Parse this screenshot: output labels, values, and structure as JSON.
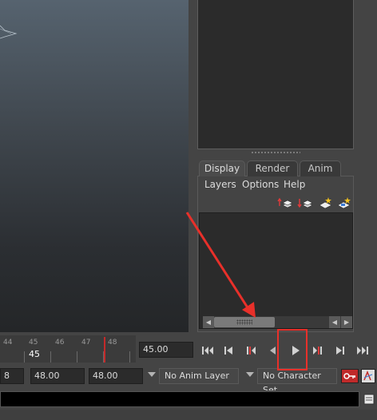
{
  "timeline": {
    "tick_labels": [
      "44",
      "45",
      "46",
      "47",
      "48"
    ],
    "current_frame": "45"
  },
  "frame_field": {
    "value": "45.00"
  },
  "layer_editor": {
    "tabs": [
      {
        "label": "Display",
        "active": true
      },
      {
        "label": "Render",
        "active": false
      },
      {
        "label": "Anim",
        "active": false
      }
    ],
    "menus": [
      "Layers",
      "Options",
      "Help"
    ],
    "icons": [
      "move-layer-up-icon",
      "move-layer-down-icon",
      "new-layer-icon",
      "new-layer-from-selected-icon"
    ]
  },
  "playback": {
    "buttons": [
      "go-to-start-icon",
      "step-back-frame-icon",
      "step-back-key-icon",
      "play-backwards-icon",
      "play-forwards-icon",
      "step-forward-key-icon",
      "step-forward-frame-icon",
      "go-to-end-icon"
    ]
  },
  "range_slider": {
    "partial_field": "8",
    "playback_end": "48.00",
    "animation_end": "48.00",
    "anim_layer": "No Anim Layer",
    "character_set": "No Character Set"
  },
  "colors": {
    "annotation": "#e8302a",
    "time_marker": "#c42a2a",
    "panel_bg": "#444444",
    "field_bg": "#2b2b2b"
  }
}
